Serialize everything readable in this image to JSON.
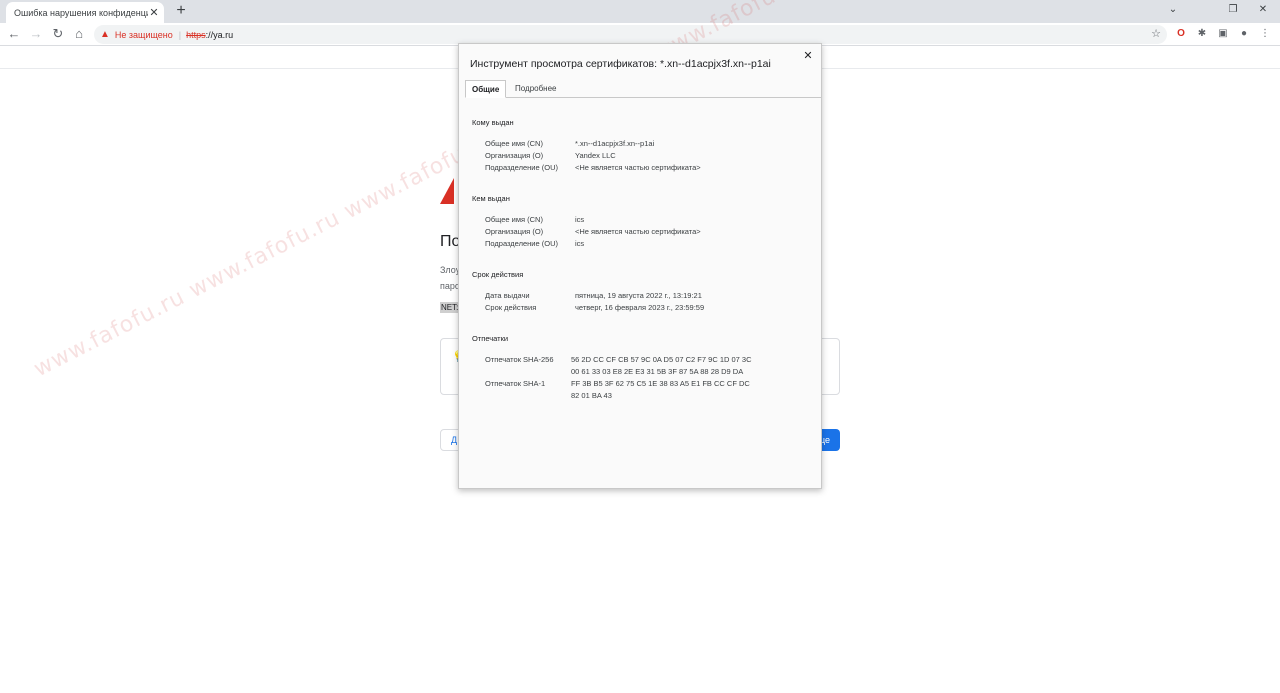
{
  "tab": {
    "title": "Ошибка нарушения конфиденциальности",
    "close": "✕"
  },
  "new_tab": "+",
  "window_controls": {
    "minimize": "⌄",
    "restore": "❐",
    "close": "✕"
  },
  "toolbar": {
    "back": "←",
    "forward": "→",
    "reload": "↻",
    "home": "⌂",
    "warning_icon": "▲",
    "not_secure": "Не защищено",
    "separator": "|",
    "url_scheme": "https",
    "url_rest": "://ya.ru",
    "bookmark_star": "☆",
    "extensions": [
      "O",
      "✱",
      "▣",
      "●",
      "⋮"
    ]
  },
  "background_page": {
    "heading_partial": "По",
    "text_line1_partial": "Злоу",
    "text_line2_partial": "паро",
    "error_code_partial": "NET::",
    "left_button_partial": "Д",
    "right_button_partial": "це",
    "bulb_icon": "💡"
  },
  "dialog": {
    "title": "Инструмент просмотра сертификатов: *.xn--d1acpjx3f.xn--p1ai",
    "close": "✕",
    "tabs": [
      {
        "label": "Общие",
        "active": true
      },
      {
        "label": "Подробнее",
        "active": false
      }
    ],
    "sections": {
      "issued_to": {
        "title": "Кому выдан",
        "rows": [
          {
            "label": "Общее имя (CN)",
            "value": "*.xn--d1acpjx3f.xn--p1ai"
          },
          {
            "label": "Организация (O)",
            "value": "Yandex LLC"
          },
          {
            "label": "Подразделение (OU)",
            "value": "<Не является частью сертификата>"
          }
        ]
      },
      "issued_by": {
        "title": "Кем выдан",
        "rows": [
          {
            "label": "Общее имя (CN)",
            "value": "ics"
          },
          {
            "label": "Организация (O)",
            "value": "<Не является частью сертификата>"
          },
          {
            "label": "Подразделение (OU)",
            "value": "ics"
          }
        ]
      },
      "validity": {
        "title": "Срок действия",
        "rows": [
          {
            "label": "Дата выдачи",
            "value": "пятница, 19 августа 2022 г., 13:19:21"
          },
          {
            "label": "Срок действия",
            "value": "четверг, 16 февраля 2023 г., 23:59:59"
          }
        ]
      },
      "fingerprints": {
        "title": "Отпечатки",
        "sha256_label": "Отпечаток SHA-256",
        "sha256_line1": "56 2D CC CF CB 57 9C 0A D5 07 C2 F7 9C 1D 07 3C",
        "sha256_line2": "00 61 33 03 E8 2E E3 31 5B 3F 87 5A 88 28 D9 DA",
        "sha1_label": "Отпечаток SHA-1",
        "sha1_line1": "FF 3B B5 3F 62 75 C5 1E 38 83 A5 E1 FB CC CF DC",
        "sha1_line2": "82 01 BA 43"
      }
    }
  },
  "watermark": "www.fafofu.ru www.fafofu.ru www.fafofu.ru www.fafofu.ru www.fafofu.ru"
}
